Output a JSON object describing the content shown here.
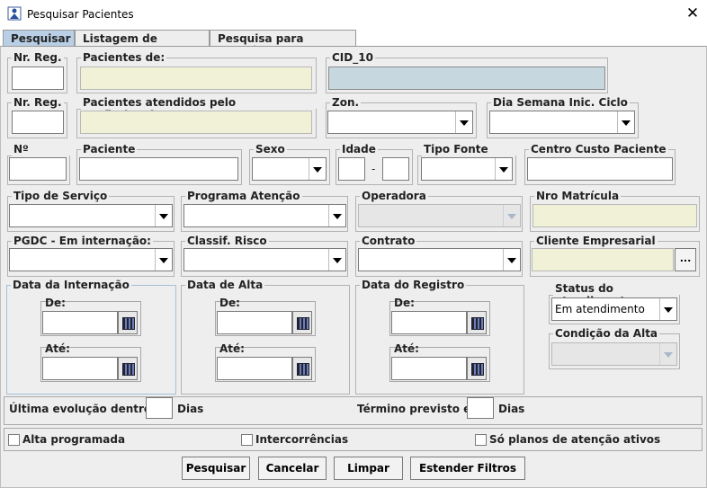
{
  "window": {
    "title": "Pesquisar Pacientes",
    "close": "✕"
  },
  "tabs": [
    "Pesquisar",
    "Listagem de Pacientes",
    "Pesquisa para Relatórios"
  ],
  "groups": {
    "nr_reg_1": "Nr. Reg.",
    "pacientes_de": "Pacientes de:",
    "cid_10": "CID_10",
    "nr_reg_2": "Nr. Reg.",
    "pac_prof": "Pacientes atendidos pelo Profissional:",
    "zon": "Zon.",
    "dia_semana": "Dia Semana Inic. Ciclo",
    "n_pront": "Nº Pront...",
    "paciente": "Paciente",
    "sexo": "Sexo",
    "idade": "Idade",
    "idade_sep": "-",
    "tipo_fonte": "Tipo Fonte Pag...",
    "centro_custo": "Centro Custo Paciente",
    "tipo_servico": "Tipo de Serviço",
    "programa": "Programa Atenção",
    "operadora": "Operadora",
    "nro_matricula": "Nro Matrícula",
    "pgdc": "PGDC - Em internação:",
    "classif": "Classif. Risco",
    "contrato": "Contrato",
    "cliente_emp": "Cliente Empresarial",
    "cliente_btn": "...",
    "data_internacao": "Data da Internação",
    "data_alta": "Data de Alta",
    "data_registro": "Data do Registro",
    "de": "De:",
    "ate": "Até:",
    "status": "Status do atendimento",
    "status_value": "Em atendimento",
    "condicao": "Condição da Alta"
  },
  "evolucao": {
    "label": "Última evolução dentro de",
    "unit": "Dias"
  },
  "termino": {
    "label": "Término previsto em",
    "unit": "Dias"
  },
  "checks": {
    "alta": "Alta programada",
    "interc": "Intercorrências",
    "planos": "Só planos de atenção ativos"
  },
  "buttons": {
    "pesquisar": "Pesquisar",
    "cancelar": "Cancelar",
    "limpar": "Limpar",
    "estender": "Estender Filtros"
  },
  "colors": {
    "yellow_field": "#f1f1d8",
    "blue_field": "#c7d7df",
    "active_tab": "#b8cfe5"
  }
}
